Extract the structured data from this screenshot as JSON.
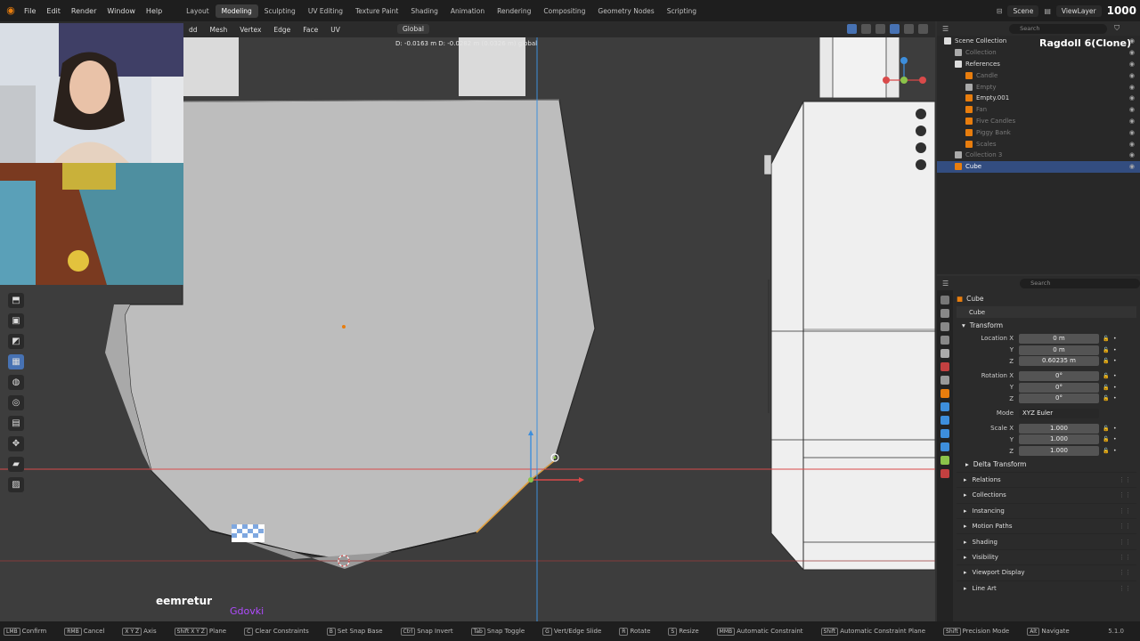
{
  "topbar": {
    "menus": [
      "File",
      "Edit",
      "Render",
      "Window",
      "Help"
    ],
    "workspaces": [
      "Layout",
      "Modeling",
      "Sculpting",
      "UV Editing",
      "Texture Paint",
      "Shading",
      "Animation",
      "Rendering",
      "Compositing",
      "Geometry Nodes",
      "Scripting"
    ],
    "active_workspace": "Modeling",
    "scene": "Scene",
    "view_layer": "ViewLayer",
    "fps": "1000"
  },
  "viewport": {
    "menus": [
      "dd",
      "Mesh",
      "Vertex",
      "Edge",
      "Face",
      "UV"
    ],
    "orientation": "Global",
    "operator_status": "D: -0.0163 m  D: -0.0282 m (0.0326 m) global"
  },
  "stream": {
    "username": "eemretur",
    "tag": "Gdovki"
  },
  "outliner": {
    "title_overlay": "Ragdoll 6(Clone)",
    "search_placeholder": "Search",
    "items": [
      {
        "label": "Scene Collection",
        "level": 0,
        "dim": false,
        "selected": false
      },
      {
        "label": "Collection",
        "level": 1,
        "dim": true,
        "selected": false
      },
      {
        "label": "References",
        "level": 1,
        "dim": false,
        "selected": false
      },
      {
        "label": "Candle",
        "level": 2,
        "dim": true,
        "selected": false
      },
      {
        "label": "Empty",
        "level": 2,
        "dim": true,
        "selected": false
      },
      {
        "label": "Empty.001",
        "level": 2,
        "dim": false,
        "selected": false
      },
      {
        "label": "Fan",
        "level": 2,
        "dim": true,
        "selected": false
      },
      {
        "label": "Five Candles",
        "level": 2,
        "dim": true,
        "selected": false
      },
      {
        "label": "Piggy Bank",
        "level": 2,
        "dim": true,
        "selected": false
      },
      {
        "label": "Scales",
        "level": 2,
        "dim": true,
        "selected": false
      },
      {
        "label": "Collection 3",
        "level": 1,
        "dim": true,
        "selected": false
      },
      {
        "label": "Cube",
        "level": 1,
        "dim": false,
        "selected": true
      }
    ]
  },
  "properties": {
    "search_placeholder": "Search",
    "object_name": "Cube",
    "object_data_name": "Cube",
    "transform_label": "Transform",
    "rows": [
      {
        "label": "Location X",
        "value": "0 m"
      },
      {
        "label": "Y",
        "value": "0 m"
      },
      {
        "label": "Z",
        "value": "0.60235 m"
      },
      {
        "label": "Rotation X",
        "value": "0°"
      },
      {
        "label": "Y",
        "value": "0°"
      },
      {
        "label": "Z",
        "value": "0°"
      }
    ],
    "mode_label": "Mode",
    "mode_value": "XYZ Euler",
    "scale_rows": [
      {
        "label": "Scale X",
        "value": "1.000"
      },
      {
        "label": "Y",
        "value": "1.000"
      },
      {
        "label": "Z",
        "value": "1.000"
      }
    ],
    "delta_transform": "Delta Transform",
    "sections": [
      "Relations",
      "Collections",
      "Instancing",
      "Motion Paths",
      "Shading",
      "Visibility",
      "Viewport Display",
      "Line Art"
    ]
  },
  "statusbar": {
    "items": [
      {
        "key": "LMB",
        "label": "Confirm"
      },
      {
        "key": "RMB",
        "label": "Cancel"
      },
      {
        "key": "X Y Z",
        "label": "Axis"
      },
      {
        "key": "Shift X Y Z",
        "label": "Plane"
      },
      {
        "key": "C",
        "label": "Clear Constraints"
      },
      {
        "key": "B",
        "label": "Set Snap Base"
      },
      {
        "key": "Ctrl",
        "label": "Snap Invert"
      },
      {
        "key": "Tab",
        "label": "Snap Toggle"
      },
      {
        "key": "G",
        "label": "Vert/Edge Slide"
      },
      {
        "key": "R",
        "label": "Rotate"
      },
      {
        "key": "S",
        "label": "Resize"
      },
      {
        "key": "MMB",
        "label": "Automatic Constraint"
      },
      {
        "key": "Shift",
        "label": "Automatic Constraint Plane"
      },
      {
        "key": "Shift",
        "label": "Precision Mode"
      },
      {
        "key": "Alt",
        "label": "Navigate"
      }
    ],
    "version": "5.1.0"
  },
  "colors": {
    "accent": "#4772b3",
    "x_axis": "#d94a4a",
    "y_axis": "#8bc34a",
    "z_axis": "#3d8edc",
    "stream_tag": "#b04bff"
  }
}
